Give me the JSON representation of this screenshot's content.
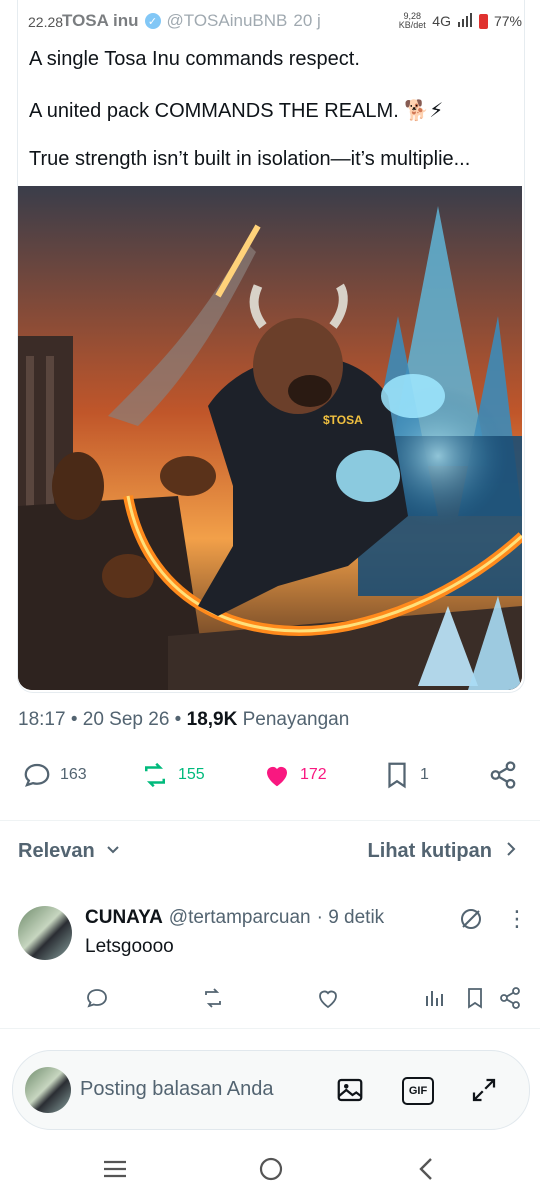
{
  "status": {
    "time": "22.28",
    "network_speed": "9,28 KB/det",
    "network": "4G",
    "battery": "77%"
  },
  "tweet": {
    "author_name": "TOSA inu",
    "author_handle": "@TOSAinuBNB",
    "time_ago": "20 j",
    "lines": [
      "A single Tosa Inu commands respect.",
      "A united pack COMMANDS THE REALM. 🐕⚡",
      "True strength isn’t built in isolation—it’s multiplie..."
    ],
    "image_shirt_text": "$TOSA",
    "meta_time": "18:17",
    "meta_date": "20 Sep 26",
    "meta_views": "18,9K",
    "meta_views_label": "Penayangan",
    "stats": {
      "replies": "163",
      "reposts": "155",
      "likes": "172",
      "bookmarks": "1"
    }
  },
  "filters": {
    "sort_label": "Relevan",
    "quotes_label": "Lihat kutipan"
  },
  "reply": {
    "name": "CUNAYA",
    "handle": "@tertamparcuan",
    "time": "· 9 detik",
    "text": "Letsgoooo"
  },
  "composer": {
    "placeholder": "Posting balasan Anda",
    "gif_label": "GIF"
  },
  "colors": {
    "accent": "#1d9bf0",
    "repost": "#00ba7c",
    "like": "#f91880",
    "muted": "#536471"
  }
}
